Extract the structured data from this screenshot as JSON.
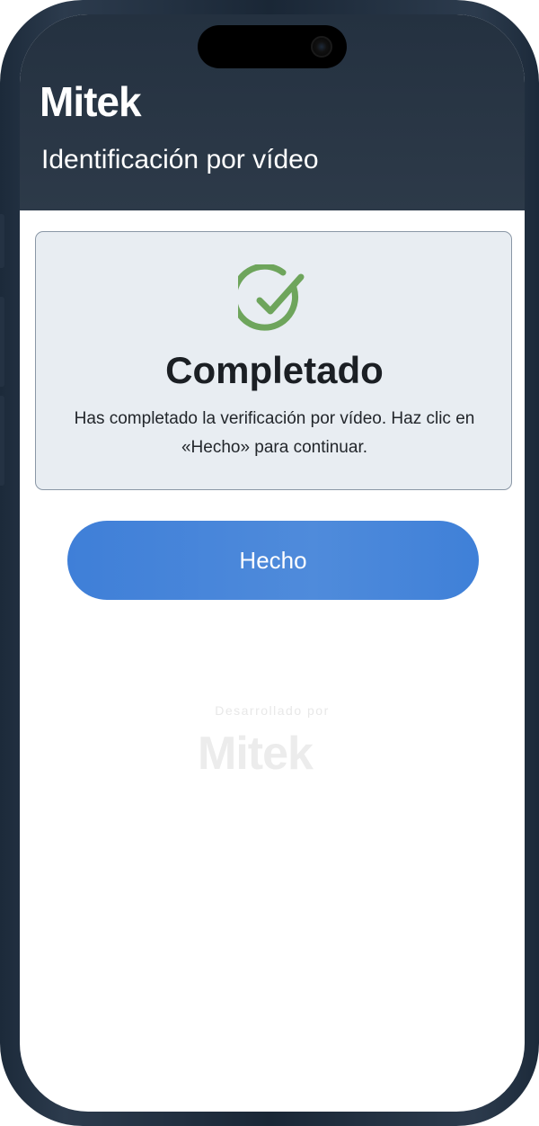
{
  "header": {
    "brand": "Mitek",
    "title": "Identificación por vídeo"
  },
  "status": {
    "icon": "check-circle-icon",
    "title": "Completado",
    "message": "Has completado la verificación por vídeo. Haz clic en «Hecho» para continuar."
  },
  "actions": {
    "done_label": "Hecho"
  },
  "footer": {
    "powered_by": "Desarrollado por",
    "brand": "Mitek"
  },
  "colors": {
    "header_bg": "#283544",
    "accent_blue": "#4a86da",
    "success_green": "#6ea55c",
    "card_bg": "#e8edf2"
  }
}
